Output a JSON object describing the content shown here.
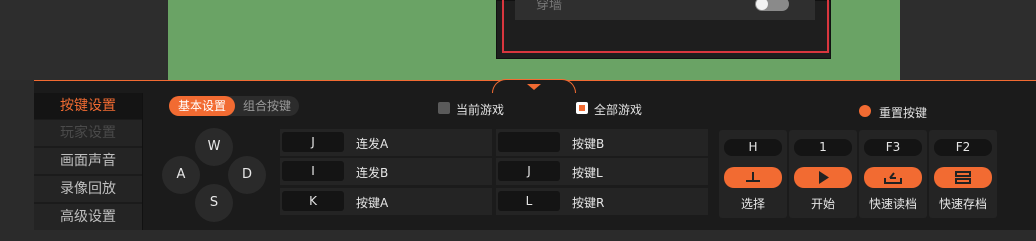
{
  "dialog": {
    "row_label": "穿墙"
  },
  "sidebar": {
    "items": [
      {
        "label": "按键设置"
      },
      {
        "label": "玩家设置"
      },
      {
        "label": "画面声音"
      },
      {
        "label": "录像回放"
      },
      {
        "label": "高级设置"
      }
    ]
  },
  "tabs": [
    "基本设置",
    "组合按键"
  ],
  "scope": {
    "current": "当前游戏",
    "all": "全部游戏"
  },
  "reset": "重置按键",
  "dpad": {
    "up": "W",
    "left": "A",
    "right": "D",
    "down": "S"
  },
  "keys": {
    "left": [
      {
        "key": "J",
        "action": "连发A"
      },
      {
        "key": "I",
        "action": "连发B"
      },
      {
        "key": "K",
        "action": "按键A"
      }
    ],
    "right": [
      {
        "key": "",
        "action": "按键B"
      },
      {
        "key": "J",
        "action": "按键L"
      },
      {
        "key": "L",
        "action": "按键R"
      }
    ]
  },
  "actions": [
    {
      "key": "H",
      "label": "选择",
      "icon": "select-icon"
    },
    {
      "key": "1",
      "label": "开始",
      "icon": "play-icon"
    },
    {
      "key": "F3",
      "label": "快速读档",
      "icon": "load-icon"
    },
    {
      "key": "F2",
      "label": "快速存档",
      "icon": "save-icon"
    }
  ],
  "colors": {
    "accent": "#f26b32",
    "game_bg": "#6aa365",
    "dialog_border": "#d9363e"
  }
}
